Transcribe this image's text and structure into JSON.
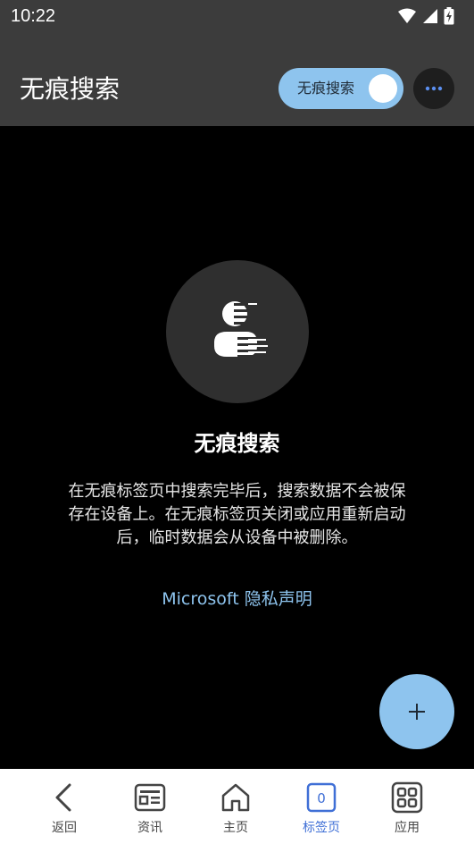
{
  "status_bar": {
    "time": "10:22"
  },
  "header": {
    "title": "无痕搜索",
    "toggle_label": "无痕搜索",
    "toggle_on": true
  },
  "main": {
    "hero_icon": "incognito-person-icon",
    "title": "无痕搜索",
    "description_lines": [
      "在无痕标签页中搜索完毕后，搜索数据不会被保",
      "存在设备上。在无痕标签页关闭或应用重新启动",
      "后，临时数据会从设备中被删除。"
    ],
    "privacy_link": "Microsoft 隐私声明"
  },
  "fab": {
    "icon": "plus-icon"
  },
  "bottom_nav": {
    "items": [
      {
        "label": "返回",
        "icon": "back-icon"
      },
      {
        "label": "资讯",
        "icon": "news-icon"
      },
      {
        "label": "主页",
        "icon": "home-icon"
      },
      {
        "label": "标签页",
        "icon": "tabs-icon",
        "count": "0",
        "active": true
      },
      {
        "label": "应用",
        "icon": "apps-icon"
      }
    ]
  },
  "colors": {
    "accent": "#8ec4ee",
    "header_bg": "#3c3c3c",
    "active_nav": "#3f6fd6"
  }
}
